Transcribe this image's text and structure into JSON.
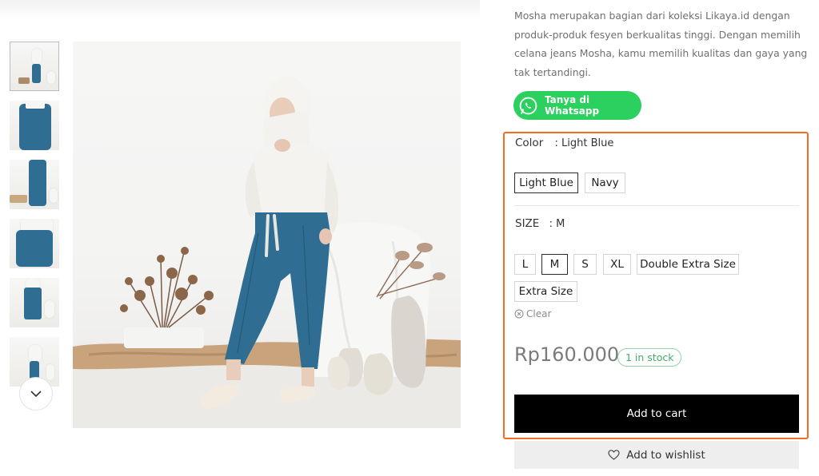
{
  "product": {
    "description": "Mosha merupakan bagian dari koleksi Likaya.id dengan produk-produk fesyen berkualitas tinggi. Dengan memilih celana jeans Mosha, kamu memilih kualitas dan gaya yang tak tertandingi.",
    "whatsapp_label": "Tanya di Whatsapp",
    "price": "Rp160.000",
    "stock": "1 in stock",
    "add_to_cart": "Add to cart",
    "add_to_wishlist": "Add to wishlist"
  },
  "color": {
    "label": "Color",
    "selected": ": Light Blue",
    "options": [
      "Light Blue",
      "Navy"
    ]
  },
  "size": {
    "label": "SIZE",
    "selected": ": M",
    "options": [
      "L",
      "M",
      "S",
      "XL",
      "Double Extra Size",
      "Extra Size"
    ]
  },
  "clear_label": "Clear",
  "colors": {
    "highlight": "#f36c21",
    "whatsapp": "#2bd05e",
    "stock_green": "#3fae62",
    "denim": "#2f6e92"
  },
  "icons": [
    "whatsapp-icon",
    "chevron-down-icon",
    "close-circle-icon",
    "heart-icon"
  ]
}
